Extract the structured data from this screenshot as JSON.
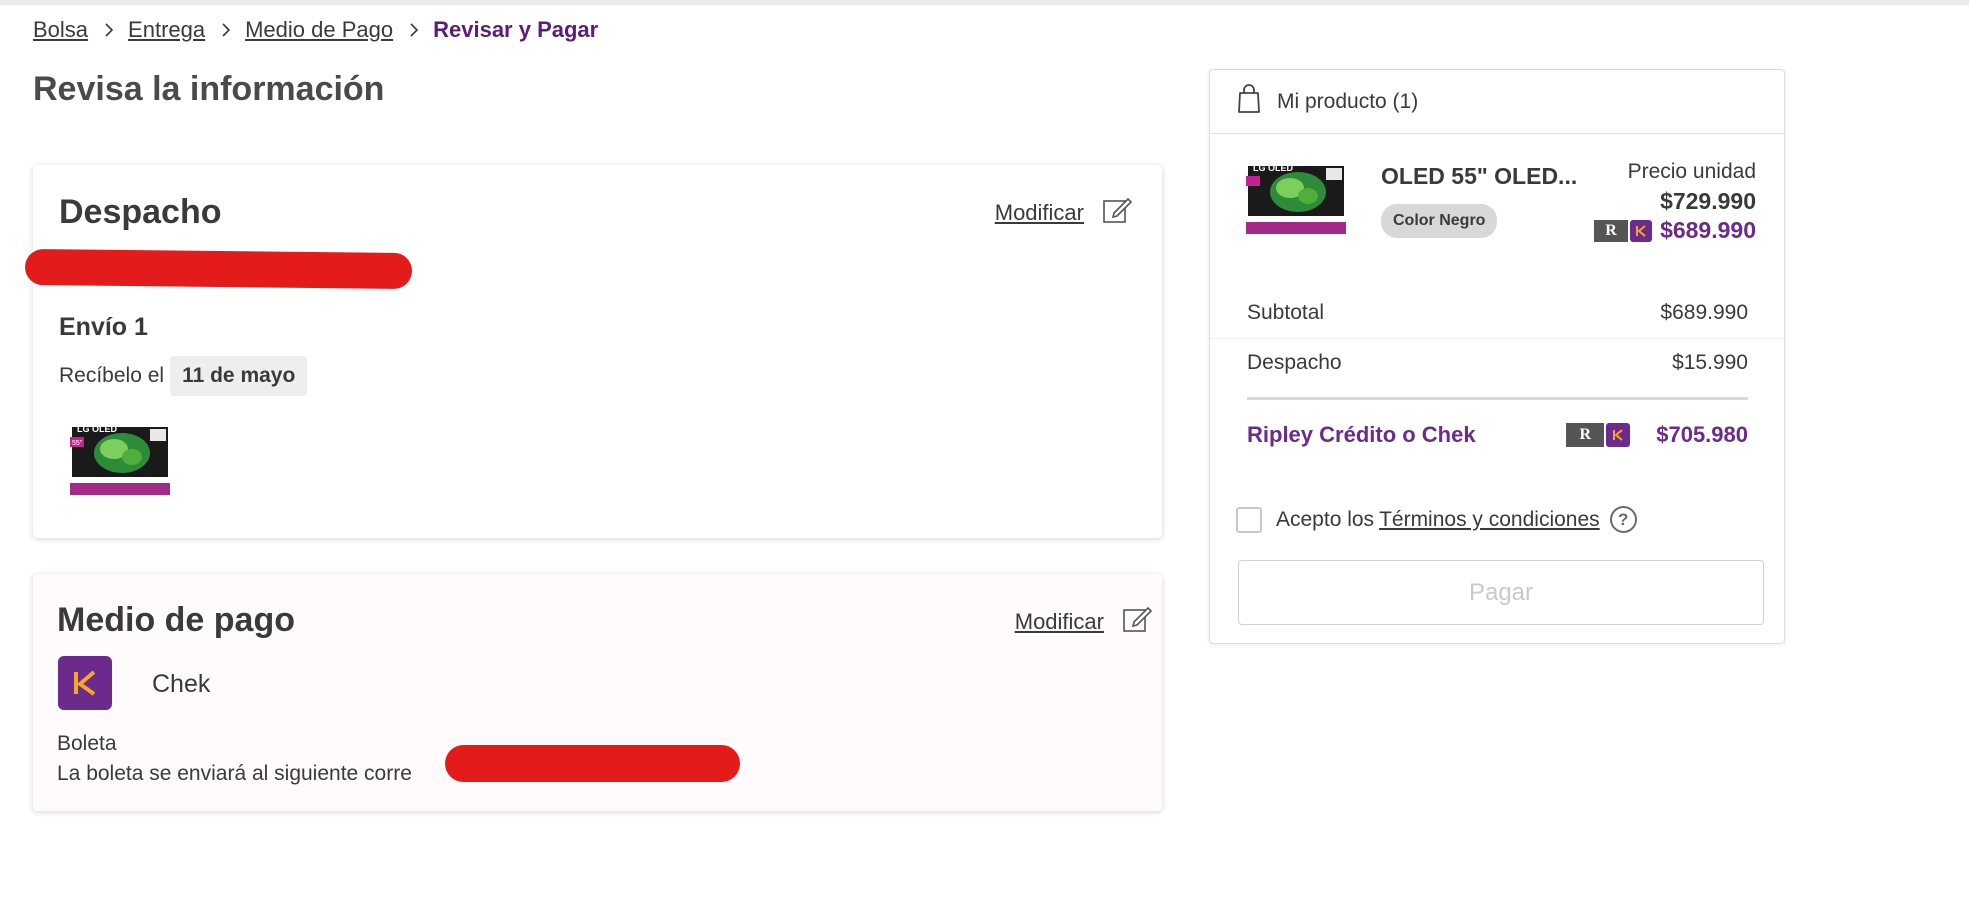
{
  "breadcrumb": {
    "items": [
      "Bolsa",
      "Entrega",
      "Medio de Pago"
    ],
    "current": "Revisar y Pagar"
  },
  "page_title": "Revisa la información",
  "despacho": {
    "title": "Despacho",
    "modify_label": "Modificar",
    "envio_title": "Envío 1",
    "recibelo_label": "Recíbelo el",
    "date": "11 de mayo",
    "thumb_brand": "LG OLED",
    "thumb_size": "55\""
  },
  "pago": {
    "title": "Medio de pago",
    "modify_label": "Modificar",
    "method_name": "Chek",
    "boleta_title": "Boleta",
    "boleta_text": "La boleta se enviará al siguiente corre"
  },
  "summary": {
    "header": "Mi producto (1)",
    "product_name": "OLED 55\" OLED...",
    "product_color": "Color Negro",
    "price_label": "Precio unidad",
    "price_normal": "$729.990",
    "price_ripley": "$689.990",
    "subtotal_label": "Subtotal",
    "subtotal_value": "$689.990",
    "despacho_label": "Despacho",
    "despacho_value": "$15.990",
    "total_label": "Ripley Crédito o Chek",
    "total_value": "$705.980",
    "terms_prefix": "Acepto los",
    "terms_link": "Términos y condiciones",
    "pay_label": "Pagar"
  },
  "colors": {
    "brand_purple": "#5c1d78",
    "ripley_purple": "#6c2a8c",
    "chek_orange": "#f5a623",
    "redaction_red": "#e31b1b"
  }
}
